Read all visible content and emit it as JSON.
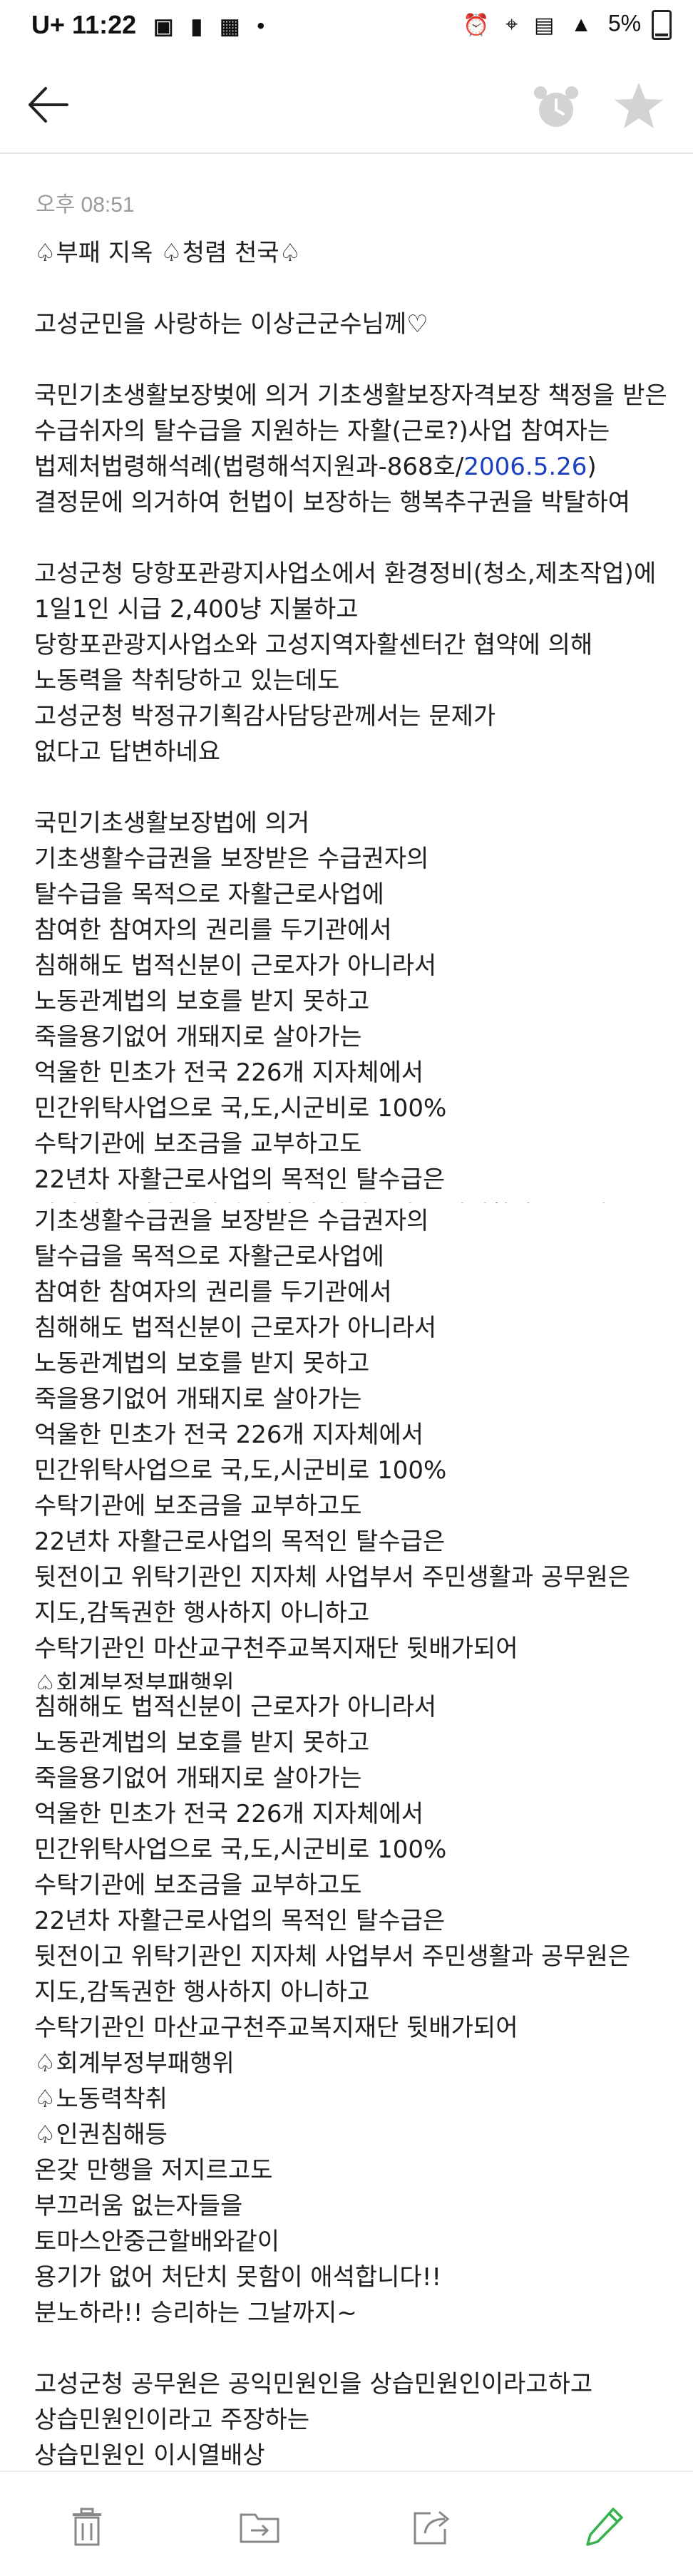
{
  "status_bar": {
    "carrier": "U+",
    "time": "11:22",
    "battery": "5%"
  },
  "app_bar": {
    "back_label": "back",
    "alarm_label": "reminder",
    "star_label": "favorite"
  },
  "message": {
    "timestamp": "오후 08:51",
    "block1": [
      "♤부패 지옥 ♤청렴 천국♤",
      "",
      "고성군민을 사랑하는 이상근군수님께♡",
      "",
      "국민기초생활보장벚에 의거 기초생활보장자격보장 책정을 받은",
      "수급쉬자의 탈수급을 지원하는 자활(근로?)사업 참여자는",
      "법제처법령해석례(법령해석지원과-868호/|2006.5.26|)",
      "결정문에 의거하여 헌법이 보장하는 행복추구권을 박탈하여",
      "",
      "고성군청 당항포관광지사업소에서 환경정비(청소,제초작업)에",
      "1일1인 시급 2,400냥 지불하고",
      "당항포관광지사업소와 고성지역자활센터간 협약에 의해",
      "노동력을 착취당하고 있는데도",
      "고성군청 박정규기획감사담당관께서는  문제가",
      "없다고 답변하네요",
      "",
      "국민기초생활보장법에 의거",
      "기초생활수급권을 보장받은 수급권자의",
      "탈수급을 목적으로 자활근로사업에",
      "참여한 참여자의 권리를 두기관에서",
      "침해해도 법적신분이 근로자가 아니라서",
      "노동관계법의 보호를 받지 못하고",
      "죽을용기없어 개돼지로 살아가는",
      "억울한 민초가 전국 226개 지자체에서",
      "민간위탁사업으로 국,도,시군비로 100%",
      "수탁기관에 보조금을 교부하고도",
      "22년차 자활근로사업의 목적인 탈수급은",
      "뒷전이고 위탁기관인 지자체 사업부서 주민생활과 공무원은"
    ],
    "block2": [
      "기초생활수급권을 보장받은 수급권자의",
      "탈수급을 목적으로 자활근로사업에",
      "참여한 참여자의 권리를 두기관에서",
      "침해해도 법적신분이 근로자가 아니라서",
      "노동관계법의 보호를 받지 못하고",
      "죽을용기없어 개돼지로 살아가는",
      "억울한 민초가 전국 226개 지자체에서",
      "민간위탁사업으로 국,도,시군비로 100%",
      "수탁기관에 보조금을 교부하고도",
      "22년차 자활근로사업의 목적인 탈수급은",
      "뒷전이고 위탁기관인 지자체 사업부서 주민생활과 공무원은",
      "지도,감독권한 행사하지 아니하고",
      "수탁기관인 마산교구천주교복지재단 뒷배가되어",
      "♤회계부정부패행위"
    ],
    "block3": [
      "침해해도 법적신분이 근로자가 아니라서",
      "노동관계법의 보호를 받지 못하고",
      "죽을용기없어 개돼지로 살아가는",
      "억울한 민초가 전국 226개 지자체에서",
      "민간위탁사업으로 국,도,시군비로 100%",
      "수탁기관에 보조금을 교부하고도",
      "22년차 자활근로사업의 목적인 탈수급은",
      "뒷전이고 위탁기관인 지자체 사업부서 주민생활과 공무원은",
      "지도,감독권한 행사하지 아니하고",
      "수탁기관인 마산교구천주교복지재단 뒷배가되어",
      "♤회계부정부패행위",
      "♤노동력착취",
      "♤인권침해등",
      "온갖 만행을 저지르고도",
      " 부끄러움 없는자들을",
      "토마스안중근할배와같이",
      "용기가 없어 처단치 못함이 애석합니다!!",
      "분노하라!! 승리하는 그날까지~",
      "",
      "고성군청 공무원은 공익민원인을 상습민원인이라고하고",
      "상습민원인이라고 주장하는",
      "상습민원인 이시열배상"
    ]
  },
  "bottom_bar": {
    "delete": "delete",
    "move": "move",
    "share": "share",
    "edit": "edit"
  }
}
